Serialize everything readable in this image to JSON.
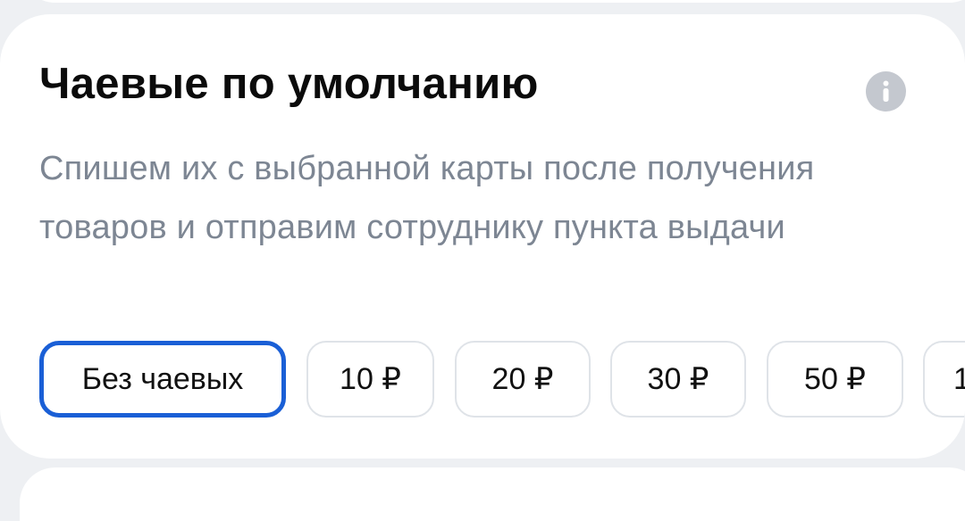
{
  "section": {
    "title": "Чаевые по умолчанию",
    "description": "Спишем их с выбранной карты после получения товаров и отправим сотруднику пункта выдачи",
    "info_icon": "info-icon"
  },
  "tips": {
    "selected_index": 0,
    "options": [
      {
        "label": "Без чаевых"
      },
      {
        "label": "10 ₽"
      },
      {
        "label": "20 ₽"
      },
      {
        "label": "30 ₽"
      },
      {
        "label": "50 ₽"
      },
      {
        "label": "1"
      }
    ]
  },
  "colors": {
    "accent": "#1a5fd6",
    "description": "#7d8693",
    "info_button": "#c4c8cf",
    "chip_border": "#dfe3e8"
  }
}
